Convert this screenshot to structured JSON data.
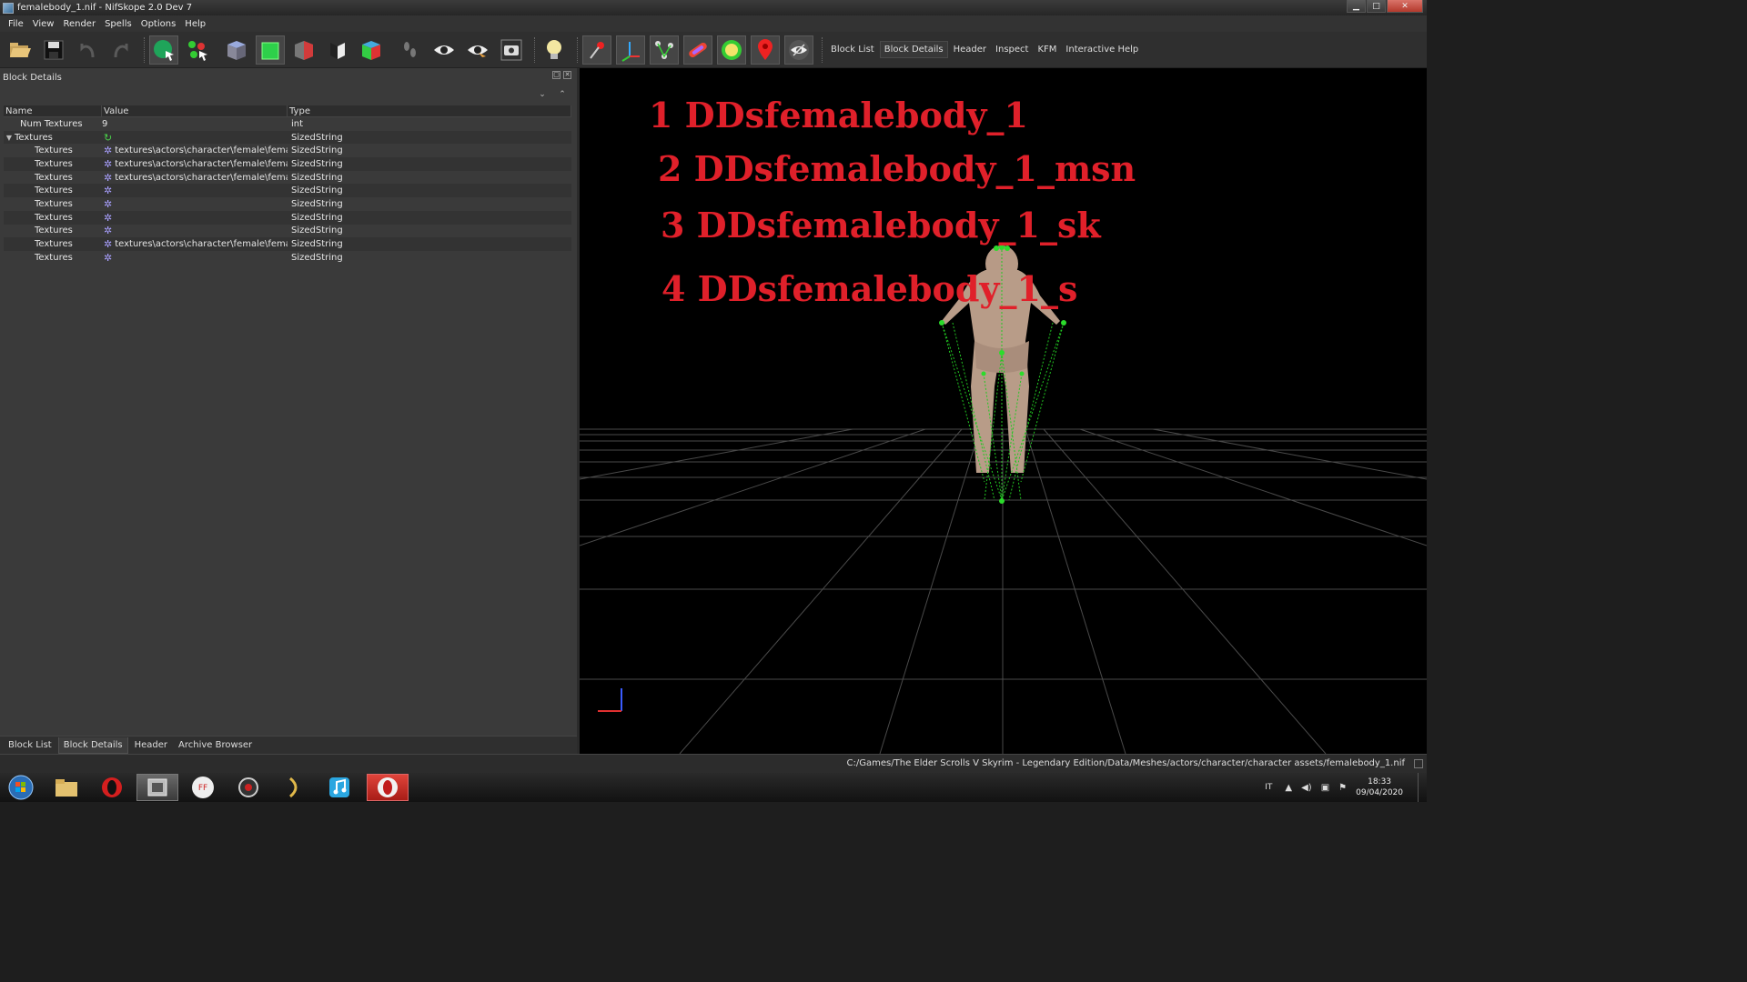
{
  "window": {
    "title": "femalebody_1.nif - NifSkope 2.0 Dev 7"
  },
  "menu": [
    "File",
    "View",
    "Render",
    "Spells",
    "Options",
    "Help"
  ],
  "toolbar": {
    "text_buttons": [
      "Block List",
      "Block Details",
      "Header",
      "Inspect",
      "KFM",
      "Interactive Help"
    ],
    "active_text_button": "Block Details"
  },
  "left_panel": {
    "title": "Block Details",
    "columns": {
      "name": "Name",
      "value": "Value",
      "type": "Type"
    },
    "rows": [
      {
        "name": "Num Textures",
        "value": "9",
        "type": "int"
      },
      {
        "name": "Textures",
        "value": "",
        "type": "SizedString"
      },
      {
        "name": "Textures",
        "value": "textures\\actors\\character\\female\\female...",
        "type": "SizedString"
      },
      {
        "name": "Textures",
        "value": "textures\\actors\\character\\female\\female...",
        "type": "SizedString"
      },
      {
        "name": "Textures",
        "value": "textures\\actors\\character\\female\\female...",
        "type": "SizedString"
      },
      {
        "name": "Textures",
        "value": "",
        "type": "SizedString"
      },
      {
        "name": "Textures",
        "value": "",
        "type": "SizedString"
      },
      {
        "name": "Textures",
        "value": "",
        "type": "SizedString"
      },
      {
        "name": "Textures",
        "value": "",
        "type": "SizedString"
      },
      {
        "name": "Textures",
        "value": "textures\\actors\\character\\female\\female...",
        "type": "SizedString"
      },
      {
        "name": "Textures",
        "value": "",
        "type": "SizedString"
      }
    ],
    "tabs": [
      "Block List",
      "Block Details",
      "Header",
      "Archive Browser"
    ],
    "active_tab": "Block Details"
  },
  "viewport": {
    "overlay_text": [
      "1 DDsfemalebody_1",
      "2 DDsfemalebody_1_msn",
      "3 DDsfemalebody_1_sk",
      "4 DDsfemalebody_1_s"
    ],
    "overlay_color": "#e0202a"
  },
  "status": {
    "path": "C:/Games/The Elder Scrolls V Skyrim - Legendary Edition/Data/Meshes/actors/character/character assets/femalebody_1.nif"
  },
  "taskbar": {
    "apps": [
      "windows-start-orb",
      "file-explorer",
      "opera-browser",
      "film-app",
      "ffdec-app",
      "gear-app",
      "misc-app",
      "music-app",
      "opera-active"
    ],
    "language": "IT",
    "time": "18:33",
    "date": "09/04/2020"
  }
}
